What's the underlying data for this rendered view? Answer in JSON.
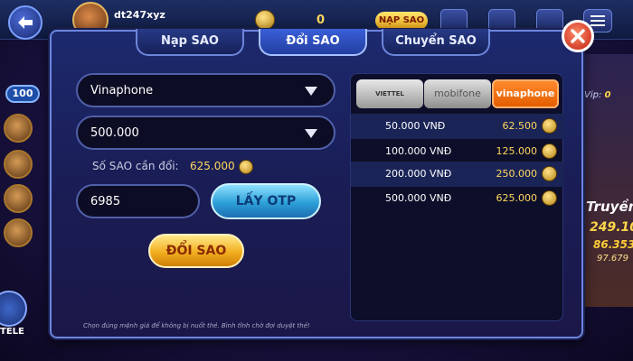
{
  "topbar": {
    "username": "dt247xyz",
    "balance": "0",
    "napsao_label": "NẠP SAO"
  },
  "sidebar": {
    "badge": "100",
    "tele_label": "TELE"
  },
  "right": {
    "vip_label": "Vip:",
    "vip_value": "0",
    "jackpot_title": "Truyền",
    "jackpot_1": "249.100",
    "jackpot_2": "86.353",
    "jackpot_3": "97.679"
  },
  "tabs": [
    {
      "label": "Nạp SAO",
      "active": false
    },
    {
      "label": "Đổi SAO",
      "active": true
    },
    {
      "label": "Chuyển SAO",
      "active": false
    }
  ],
  "form": {
    "carrier_value": "Vinaphone",
    "amount_value": "500.000",
    "need_label": "Số SAO cần đổi:",
    "need_value": "625.000",
    "otp_value": "6985",
    "otp_button": "LẤY OTP",
    "submit_button": "ĐỔI SAO"
  },
  "note": "Chọn đúng mệnh giá để không bị nuốt thẻ. Bình tĩnh chờ đợi duyệt thẻ!",
  "carriers": [
    {
      "label": "VIETTEL"
    },
    {
      "label": "mobifone"
    },
    {
      "label": "vinaphone"
    }
  ],
  "rates": [
    {
      "card": "50.000 VNĐ",
      "stars": "62.500"
    },
    {
      "card": "100.000 VNĐ",
      "stars": "125.000"
    },
    {
      "card": "200.000 VNĐ",
      "stars": "250.000"
    },
    {
      "card": "500.000 VNĐ",
      "stars": "625.000"
    }
  ],
  "colors": {
    "accent_gold": "#ffd75e",
    "vinaphone_orange": "#e45d00",
    "otp_blue": "#2d9fd8"
  }
}
